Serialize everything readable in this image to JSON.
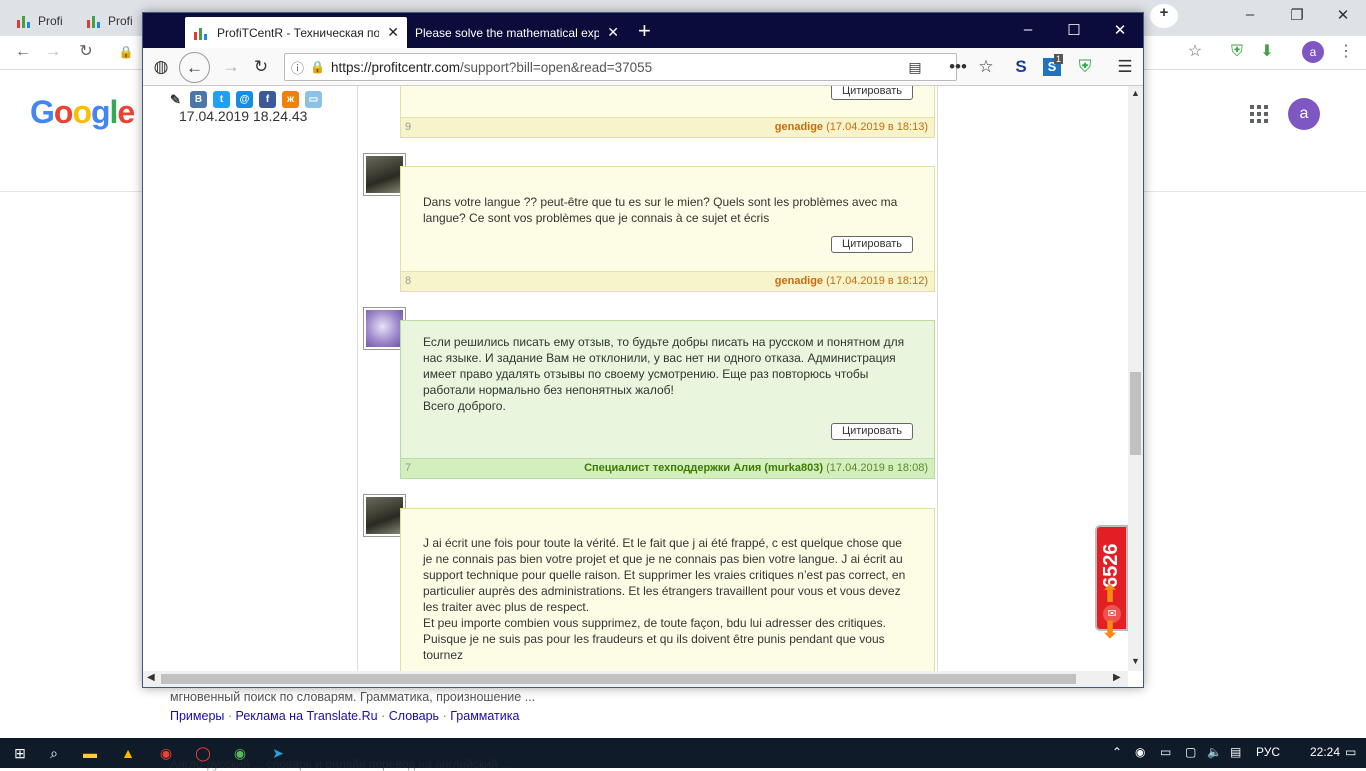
{
  "chrome": {
    "tabs": [
      {
        "label": "Profi"
      },
      {
        "label": "Profi"
      }
    ],
    "url_icons": [
      "back-icon",
      "forward-icon",
      "reload-icon",
      "lock-icon"
    ],
    "profile_letter": "a"
  },
  "google": {
    "logo": "Google",
    "profile_letter": "a",
    "snippet": "мгновенный поиск по словарям. Грамматика, произношение ...",
    "links": [
      "Примеры",
      "Реклама на Translate.Ru",
      "Словарь",
      "Грамматика"
    ],
    "link_sep": "·",
    "cut_text": "Англо-русский ... словарь и онлайн перевод на английский ..."
  },
  "firefox": {
    "tabs": [
      {
        "title": "ProfiTCentR - Техническая поддержка"
      },
      {
        "title": "Please solve the mathematical expression"
      }
    ],
    "newtab": "+",
    "url": {
      "host": "https://profitcentr.com",
      "rest": "/support?bill=open&read=37055"
    },
    "ext_s": "S",
    "ext_badge": "1"
  },
  "page": {
    "left_date": "17.04.2019 18.24.43",
    "quote_label": "Цитировать",
    "messages": [
      {
        "num": "9",
        "author": "genadige",
        "date": "(17.04.2019 в 18:13)",
        "text": "",
        "style": "yellow"
      },
      {
        "num": "8",
        "author": "genadige",
        "date": "(17.04.2019 в 18:12)",
        "text": "Dans votre langue ?? peut-être que tu es sur le mien? Quels sont les problèmes avec ma langue? Ce sont vos problèmes que je connais à ce sujet et écris",
        "style": "yellow"
      },
      {
        "num": "7",
        "author": "Специалист техподдержки Алия (murka803)",
        "date": "(17.04.2019 в 18:08)",
        "text": "Если решились писать ему отзыв, то будьте добры писать на русском и понятном для нас языке. И задание Вам не отклонили, у вас нет ни одного отказа. Администрация имеет право удалять отзывы по своему усмотрению. Еще раз повторюсь чтобы работали нормально без непонятных жалоб!\nВсего доброго.",
        "style": "green"
      },
      {
        "num": "",
        "author": "",
        "date": "",
        "text": "J ai écrit une fois pour toute la vérité. Et le fait que j ai été frappé, c est quelque chose que je ne connais pas bien votre projet et que je ne connais pas bien votre langue. J ai écrit au support technique pour quelle raison. Et supprimer les vraies critiques n’est pas correct, en particulier auprès des administrations. Et les étrangers travaillent pour vous et vous devez les traiter avec plus de respect.\nEt peu importe combien vous supprimez, de toute façon, bdu lui adresser des critiques. Puisque je ne suis pas pour les fraudeurs et qu ils doivent être punis pendant que vous tournez",
        "style": "yellow"
      }
    ],
    "counter": "6526"
  },
  "taskbar": {
    "lang": "РУС",
    "time": "22:24"
  },
  "colors": {
    "accent_red": "#e31e24",
    "firefox_tabbar": "#0c0c3c",
    "taskbar": "#101b29"
  }
}
